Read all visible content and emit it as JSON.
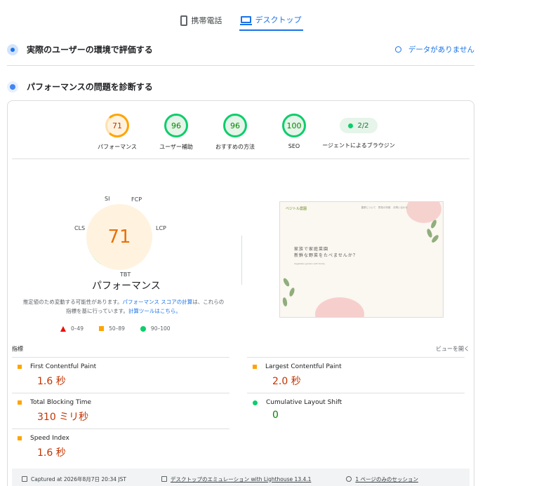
{
  "tabs": [
    {
      "label": "携帯電話",
      "icon": "phone-icon"
    },
    {
      "label": "デスクトップ",
      "icon": "desktop-icon"
    }
  ],
  "field": {
    "title": "実際のユーザーの環境で評価する",
    "status": "データがありません"
  },
  "lab": {
    "title": "パフォーマンスの問題を診断する"
  },
  "scores": [
    {
      "value": "71",
      "label": "パフォーマンス"
    },
    {
      "value": "96",
      "label": "ユーザー補助"
    },
    {
      "value": "96",
      "label": "おすすめの方法"
    },
    {
      "value": "100",
      "label": "SEO"
    }
  ],
  "agent": {
    "value": "2/2",
    "label": "ージェントによるブラウジン"
  },
  "perf": {
    "score": "71",
    "title": "パフォーマンス",
    "segments": {
      "si": "SI",
      "fcp": "FCP",
      "lcp": "LCP",
      "tbt": "TBT",
      "cls": "CLS"
    },
    "note_a": "推定値のため変動する可能性があります。",
    "note_link1": "パフォーマンス スコアの計算",
    "note_b": "は、これらの指標を基に行っています。",
    "note_link2": "計算ツールはこちら。"
  },
  "legend": {
    "fail": "0–49",
    "avg": "50–89",
    "pass": "90–100"
  },
  "preview": {
    "logo": "ベジトル農園",
    "nav": "農業について　野菜の特徴　お問い合わせ",
    "headline1": "家族で家庭菜園",
    "headline2": "新鮮な野菜をたべませんか？",
    "sub": "Vegetable garden with family"
  },
  "metrics": {
    "header": "指標",
    "expand": "ビューを開く",
    "items": [
      {
        "name": "First Contentful Paint",
        "value": "1.6 秒"
      },
      {
        "name": "Largest Contentful Paint",
        "value": "2.0 秒"
      },
      {
        "name": "Total Blocking Time",
        "value": "310 ミリ秒"
      },
      {
        "name": "Cumulative Layout Shift",
        "value": "0"
      },
      {
        "name": "Speed Index",
        "value": "1.6 秒"
      }
    ]
  },
  "footer": {
    "captured": "Captured at 2026年8月7日 20:34 JST",
    "emulation": "デスクトップのエミュレーション with Lighthouse 13.4.1",
    "session": "1 ページのみのセッション"
  },
  "colors": {
    "accent": "#1a73e8",
    "orange": "#ffa400",
    "green": "#0cce6b",
    "red": "#eb0f00"
  }
}
